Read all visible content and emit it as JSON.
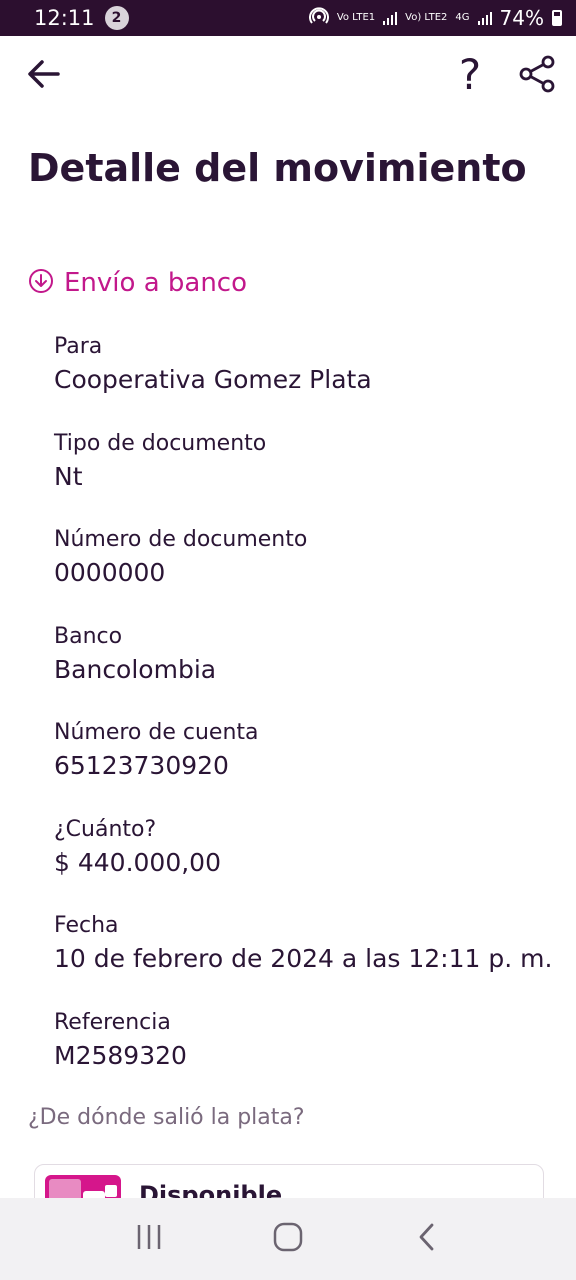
{
  "status_bar": {
    "time": "12:11",
    "notification_count": "2",
    "sim1_label": "Vo LTE1",
    "sim2_label": "Vo) LTE2",
    "network": "4G",
    "battery": "74%"
  },
  "top_bar": {
    "back_icon": "arrow-left",
    "help_label": "?",
    "share_icon": "share"
  },
  "page": {
    "title": "Detalle del movimiento",
    "transaction_type": "Envío a banco",
    "transaction_icon": "arrow-down-circle"
  },
  "details": [
    {
      "label": "Para",
      "value": "Cooperativa Gomez Plata"
    },
    {
      "label": "Tipo de documento",
      "value": "Nt"
    },
    {
      "label": "Número de documento",
      "value": "0000000"
    },
    {
      "label": "Banco",
      "value": "Bancolombia"
    },
    {
      "label": "Número de cuenta",
      "value": "65123730920"
    },
    {
      "label": "¿Cuánto?",
      "value": "$ 440.000,00"
    },
    {
      "label": "Fecha",
      "value": "10 de febrero de 2024 a las 12:11 p. m."
    },
    {
      "label": "Referencia",
      "value": "M2589320"
    }
  ],
  "source": {
    "question": "¿De dónde salió la plata?",
    "name": "Disponible",
    "icon": "wallet"
  },
  "colors": {
    "accent": "#c2188b",
    "status_bar": "#2c0f2f",
    "text": "#2a1535"
  }
}
